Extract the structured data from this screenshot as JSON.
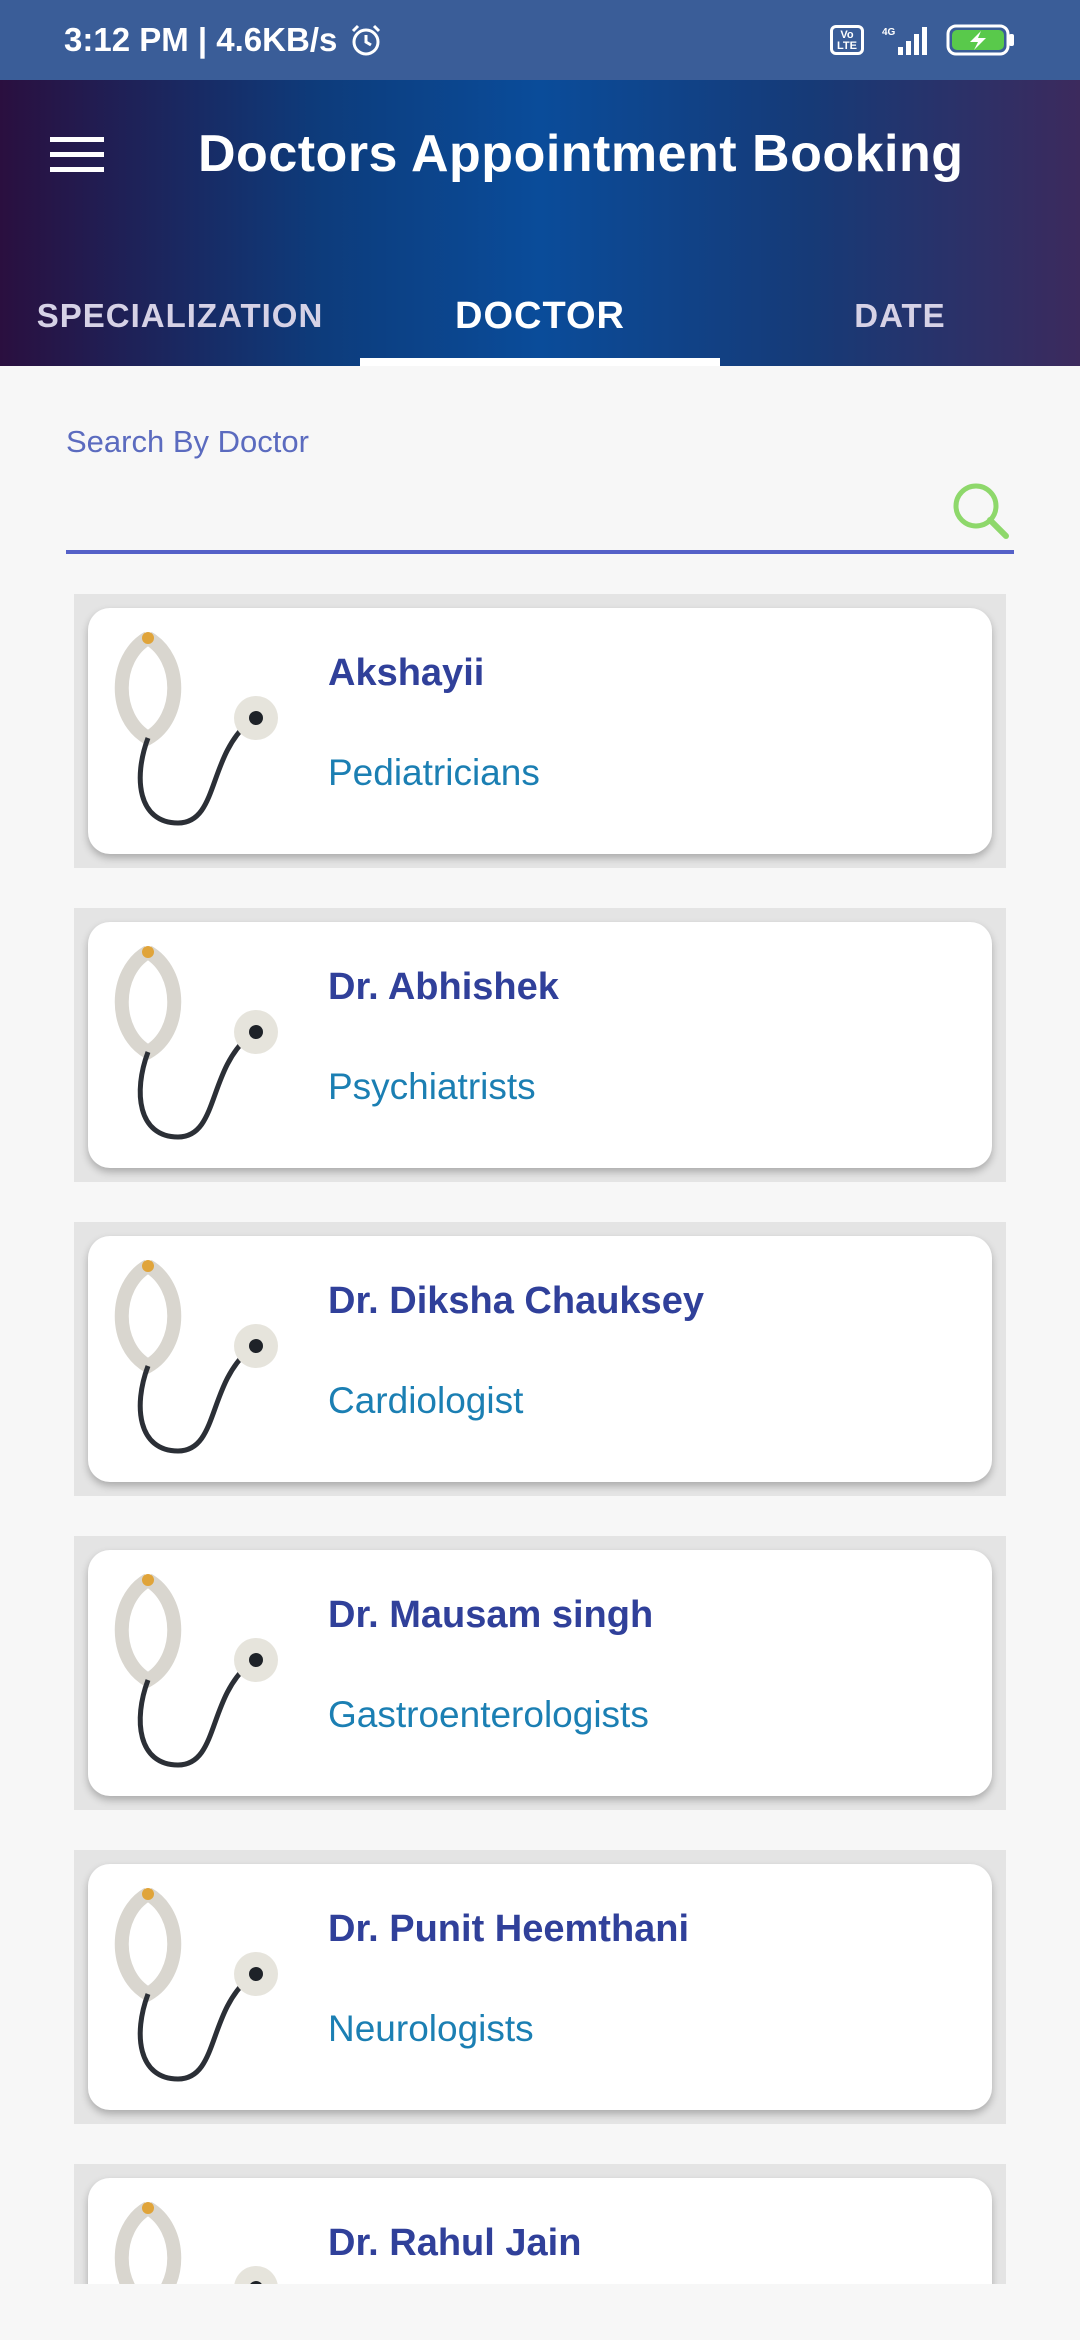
{
  "status_bar": {
    "time": "3:12 PM | 4.6KB/s",
    "volte": "Vo LTE",
    "network": "4G"
  },
  "header": {
    "title": "Doctors Appointment Booking",
    "tabs": [
      {
        "label": "SPECIALIZATION",
        "active": false
      },
      {
        "label": "DOCTOR",
        "active": true
      },
      {
        "label": "DATE",
        "active": false
      }
    ]
  },
  "search": {
    "label": "Search By Doctor",
    "value": "",
    "placeholder": ""
  },
  "doctors": [
    {
      "name": "Akshayii",
      "specialization": "Pediatricians"
    },
    {
      "name": "Dr. Abhishek",
      "specialization": "Psychiatrists"
    },
    {
      "name": "Dr. Diksha Chauksey",
      "specialization": "Cardiologist"
    },
    {
      "name": "Dr. Mausam singh",
      "specialization": "Gastroenterologists"
    },
    {
      "name": "Dr. Punit Heemthani",
      "specialization": "Neurologists"
    },
    {
      "name": "Dr. Rahul Jain",
      "specialization": ""
    }
  ],
  "colors": {
    "accent": "#5561c8",
    "name": "#30409a",
    "specialization": "#1b7fb3",
    "search_icon": "#8ed86b"
  }
}
